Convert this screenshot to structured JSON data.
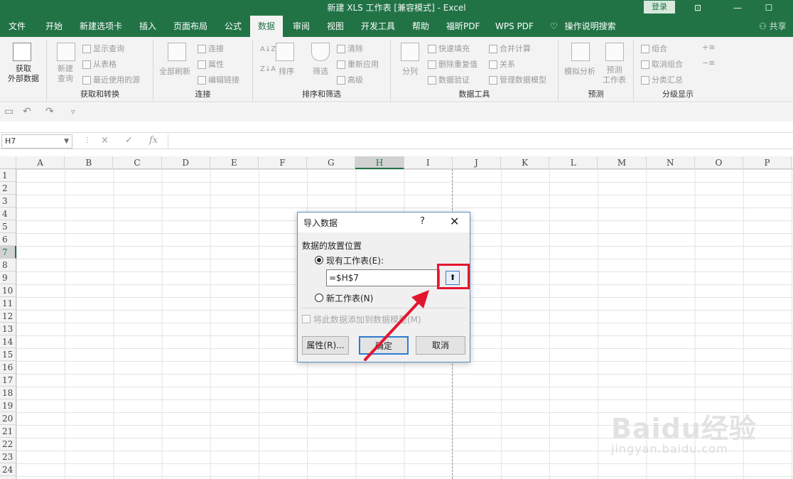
{
  "window": {
    "title": "新建 XLS 工作表  [兼容模式]  -  Excel",
    "login_label": "登录",
    "controls": [
      "⊡",
      "—",
      "☐"
    ]
  },
  "tabs": [
    {
      "label": "文件"
    },
    {
      "label": "开始"
    },
    {
      "label": "新建选项卡"
    },
    {
      "label": "插入"
    },
    {
      "label": "页面布局"
    },
    {
      "label": "公式"
    },
    {
      "label": "数据",
      "active": true
    },
    {
      "label": "审阅"
    },
    {
      "label": "视图"
    },
    {
      "label": "开发工具"
    },
    {
      "label": "帮助"
    },
    {
      "label": "福昕PDF"
    },
    {
      "label": "WPS PDF"
    }
  ],
  "tell_me": "操作说明搜索",
  "share": "共享",
  "ribbon": {
    "get_external": "获取\n外部数据",
    "get_transform": {
      "label": "获取和转换",
      "new_query": "新建\n查询",
      "items": [
        "显示查询",
        "从表格",
        "最近使用的源"
      ]
    },
    "connections": {
      "label": "连接",
      "refresh_all": "全部刷新",
      "items": [
        "连接",
        "属性",
        "编辑链接"
      ]
    },
    "sort_filter": {
      "label": "排序和筛选",
      "sort": "排序",
      "filter": "筛选",
      "items": [
        "清除",
        "重新应用",
        "高级"
      ]
    },
    "data_tools": {
      "label": "数据工具",
      "split": "分列",
      "items": [
        "快速填充",
        "删除重复值",
        "数据验证",
        "合并计算",
        "关系",
        "管理数据模型"
      ]
    },
    "forecast": {
      "label": "预测",
      "whatif": "模拟分析",
      "forecast_sheet": "预测\n工作表"
    },
    "outline": {
      "label": "分级显示",
      "items": [
        "组合",
        "取消组合",
        "分类汇总"
      ]
    }
  },
  "namebox": "H7",
  "formula_icons": [
    "×",
    "✓",
    "fx"
  ],
  "grid": {
    "columns": [
      "A",
      "B",
      "C",
      "D",
      "E",
      "F",
      "G",
      "H",
      "I",
      "J",
      "K",
      "L",
      "M",
      "N",
      "O",
      "P"
    ],
    "rows": [
      "1",
      "2",
      "3",
      "4",
      "5",
      "6",
      "7",
      "8",
      "9",
      "10",
      "11",
      "12",
      "13",
      "14",
      "15",
      "16",
      "17",
      "18",
      "19",
      "20",
      "21",
      "22",
      "23",
      "24"
    ],
    "selected_column": "H",
    "selected_row": "7"
  },
  "dialog": {
    "title": "导入数据",
    "help": "?",
    "close": "✕",
    "section": "数据的放置位置",
    "existing_sheet": "现有工作表(E):",
    "reference": "=$H$7",
    "new_sheet": "新工作表(N)",
    "add_to_model": "将此数据添加到数据模型(M)",
    "properties_btn": "属性(R)...",
    "ok_btn": "确定",
    "cancel_btn": "取消"
  },
  "watermark": {
    "brand": "Baidu经验",
    "url": "jingyan.baidu.com"
  },
  "colors": {
    "excel_green": "#217346",
    "highlight_red": "#e4162f"
  }
}
